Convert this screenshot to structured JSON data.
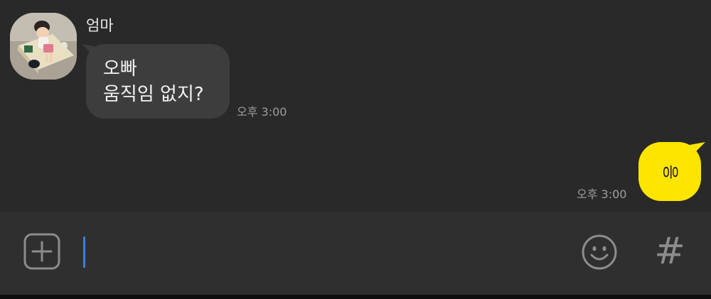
{
  "chat": {
    "incoming": {
      "sender_name": "엄마",
      "lines": [
        "오빠",
        "움직임 없지?"
      ],
      "time": "오후 3:00"
    },
    "outgoing": {
      "text": "응",
      "time": "오후 3:00"
    }
  },
  "input_bar": {
    "icons": {
      "add": "plus-square-icon",
      "emoji": "smiley-icon",
      "hashtag": "hashtag-icon"
    },
    "hashtag_symbol": "#"
  },
  "colors": {
    "background": "#292929",
    "incoming_bubble": "#3d3d3d",
    "outgoing_bubble": "#fee500",
    "input_bar": "#2f2f2f",
    "cursor": "#3d7fd8"
  }
}
